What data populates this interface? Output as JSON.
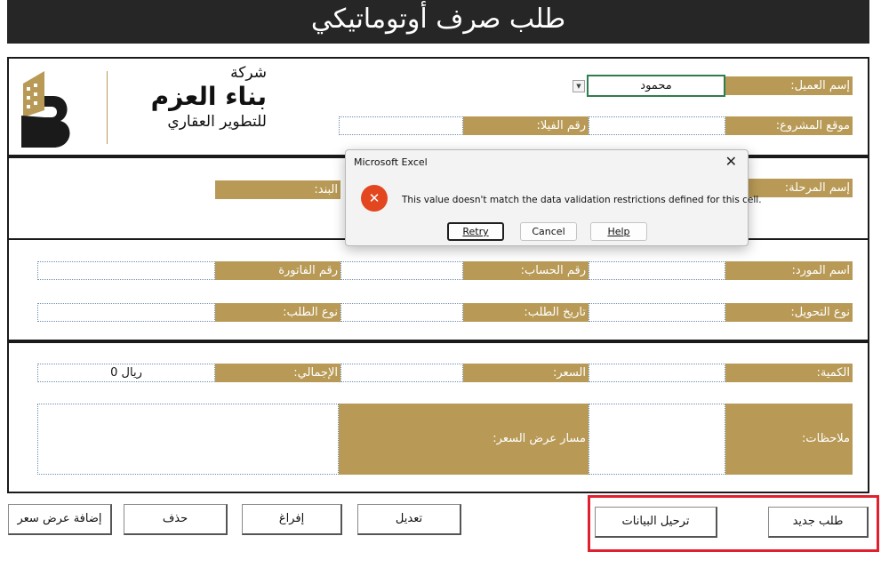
{
  "title": "طلب صرف أوتوماتيكي",
  "logo": {
    "line1": "شركة",
    "line2": "بناء العزم",
    "line3": "للتطوير العقاري"
  },
  "fields": {
    "client_label": "إسم العميل:",
    "client_value": "محمود",
    "project_location_label": "موقع المشروع:",
    "villa_no_label": "رقم الفيلا:",
    "phase_label": "إسم المرحلة:",
    "item_label": "البند:",
    "supplier_label": "اسم المورد:",
    "account_no_label": "رقم الحساب:",
    "invoice_no_label": "رقم الفاتورة",
    "transfer_type_label": "نوع التحويل:",
    "request_date_label": "تاريخ الطلب:",
    "request_type_label": "نوع الطلب:",
    "quantity_label": "الكمية:",
    "price_label": "السعر:",
    "total_label": "الإجمالي:",
    "total_value": "ريال  0",
    "notes_label": "ملاحظات:",
    "quote_path_label": "مسار عرض السعر:"
  },
  "dialog": {
    "title": "Microsoft Excel",
    "close": "✕",
    "icon_glyph": "✕",
    "message": "This value doesn't match the data validation restrictions defined for this cell.",
    "retry": "Retry",
    "cancel": "Cancel",
    "help": "Help"
  },
  "buttons": {
    "new_request": "طلب جديد",
    "post_data": "ترحيل البيانات",
    "edit": "تعديل",
    "clear": "إفراغ",
    "delete": "حذف",
    "add_quote": "إضافة عرض سعر"
  },
  "colors": {
    "label_gold": "#b89a56",
    "title_bar": "#262626",
    "highlight_red": "#e0202e",
    "error_icon": "#e2471f"
  }
}
